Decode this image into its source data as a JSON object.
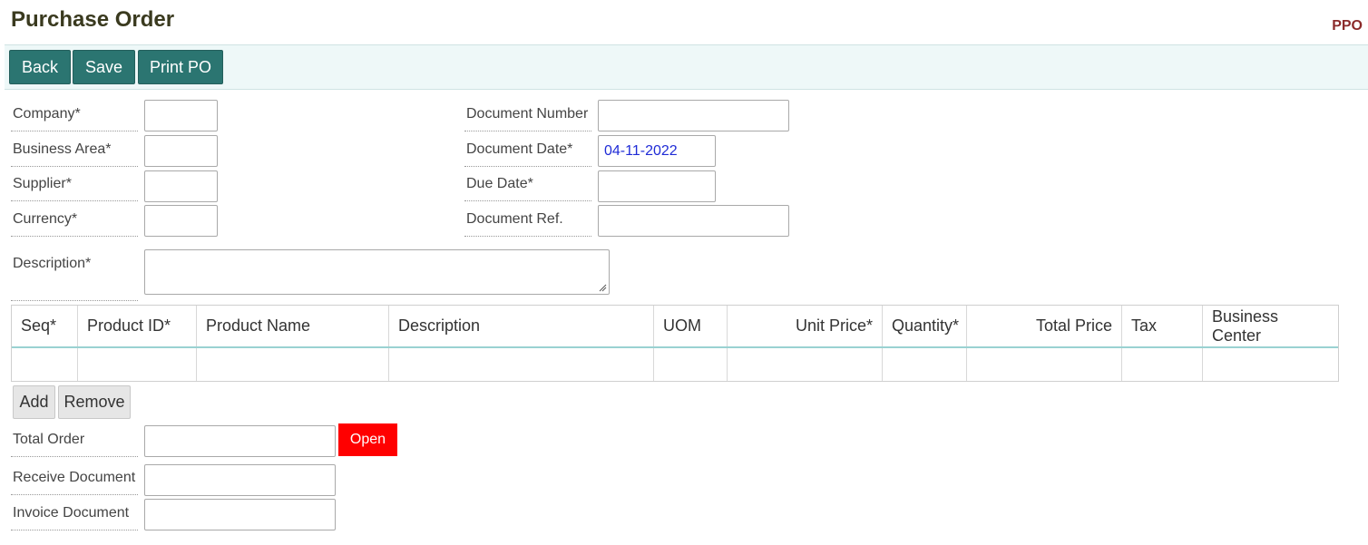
{
  "header": {
    "title": "Purchase Order",
    "code": "PPO"
  },
  "toolbar": {
    "back": "Back",
    "save": "Save",
    "print": "Print PO"
  },
  "form": {
    "company": {
      "label": "Company*",
      "value": ""
    },
    "business_area": {
      "label": "Business Area*",
      "value": ""
    },
    "supplier": {
      "label": "Supplier*",
      "value": ""
    },
    "currency": {
      "label": "Currency*",
      "value": ""
    },
    "document_number": {
      "label": "Document Number",
      "value": ""
    },
    "document_date": {
      "label": "Document Date*",
      "value": "04-11-2022"
    },
    "due_date": {
      "label": "Due Date*",
      "value": ""
    },
    "document_ref": {
      "label": "Document Ref.",
      "value": ""
    },
    "description": {
      "label": "Description*",
      "value": ""
    }
  },
  "grid": {
    "columns": [
      "Seq*",
      "Product ID*",
      "Product Name",
      "Description",
      "UOM",
      "Unit Price*",
      "Quantity*",
      "Total Price",
      "Tax",
      "Business Center"
    ]
  },
  "grid_buttons": {
    "add": "Add",
    "remove": "Remove"
  },
  "footer": {
    "total_order": {
      "label": "Total Order",
      "value": ""
    },
    "status": "Open",
    "receive_document": {
      "label": "Receive Document",
      "value": ""
    },
    "invoice_document": {
      "label": "Invoice Document",
      "value": ""
    }
  },
  "colors": {
    "accent": "#2b7571",
    "status_open": "#ff0000",
    "title": "#3a3a1f",
    "code": "#8b2a2a"
  }
}
